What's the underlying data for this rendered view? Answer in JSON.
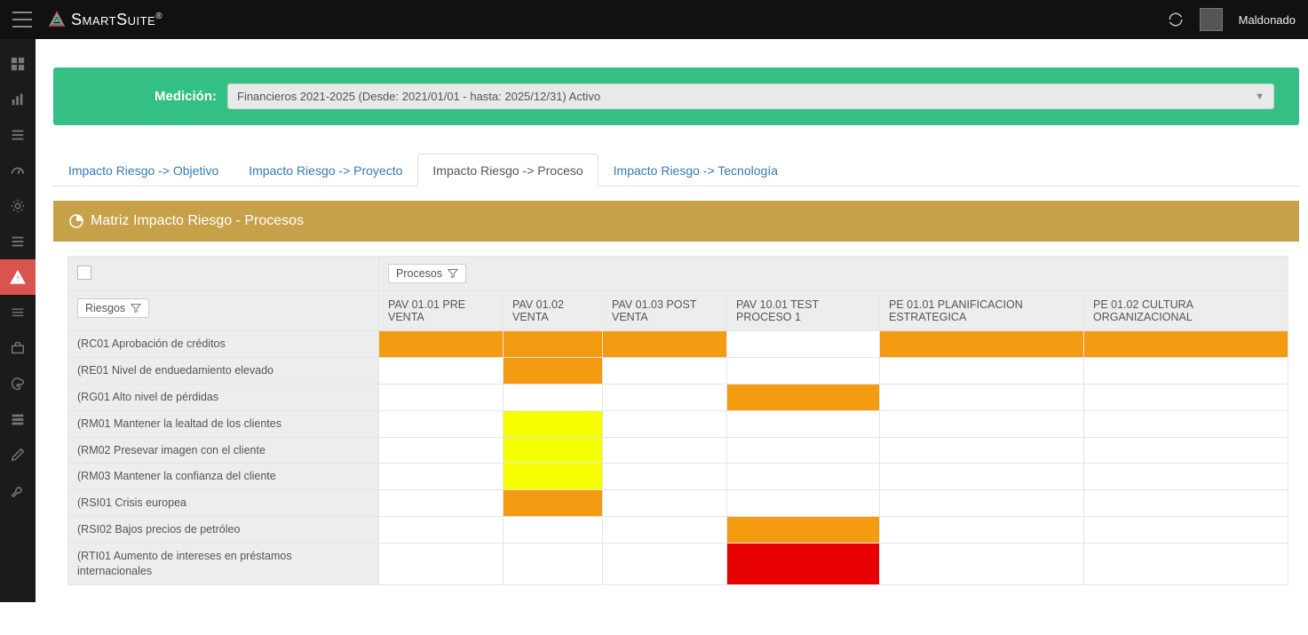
{
  "brand": "SmartSuite",
  "brand_mark": "®",
  "user": {
    "name": "Maldonado"
  },
  "siderail": [
    {
      "name": "dashboard-icon"
    },
    {
      "name": "bar-chart-icon"
    },
    {
      "name": "list-icon"
    },
    {
      "name": "gauge-icon"
    },
    {
      "name": "gear-icon"
    },
    {
      "name": "list2-icon"
    },
    {
      "name": "warning-icon",
      "active": true
    },
    {
      "name": "lines-icon"
    },
    {
      "name": "briefcase-icon"
    },
    {
      "name": "palette-icon"
    },
    {
      "name": "rows-icon"
    },
    {
      "name": "pencil-icon"
    },
    {
      "name": "wrench-icon"
    }
  ],
  "measurement": {
    "label": "Medición:",
    "value": "Financieros 2021-2025 (Desde: 2021/01/01 - hasta: 2025/12/31)  Activo"
  },
  "tabs": [
    {
      "label": "Impacto Riesgo -> Objetivo",
      "active": false
    },
    {
      "label": "Impacto Riesgo -> Proyecto",
      "active": false
    },
    {
      "label": "Impacto Riesgo -> Proceso",
      "active": true
    },
    {
      "label": "Impacto Riesgo -> Tecnología",
      "active": false
    }
  ],
  "panel_title": "Matriz Impacto Riesgo - Procesos",
  "filters": {
    "riesgos": "Riesgos",
    "procesos": "Procesos"
  },
  "columns": [
    "PAV 01.01 PRE VENTA",
    "PAV 01.02 VENTA",
    "PAV 01.03 POST VENTA",
    "PAV 10.01 TEST PROCESO 1",
    "PE 01.01 PLANIFICACION ESTRATEGICA",
    "PE 01.02 CULTURA ORGANIZACIONAL"
  ],
  "rows": [
    {
      "label": "(RC01 Aprobación de créditos",
      "tall": true,
      "cells": [
        "orange",
        "orange",
        "orange",
        "white",
        "orange",
        "orange"
      ]
    },
    {
      "label": "(RE01 Nivel de enduedamiento elevado",
      "cells": [
        "white",
        "orange",
        "white",
        "white",
        "white",
        "white"
      ]
    },
    {
      "label": "(RG01 Alto nivel de pérdidas",
      "cells": [
        "white",
        "white",
        "white",
        "orange",
        "white",
        "white"
      ]
    },
    {
      "label": "(RM01 Mantener la lealtad de los clientes",
      "cells": [
        "white",
        "yellow",
        "white",
        "white",
        "white",
        "white"
      ]
    },
    {
      "label": "(RM02 Presevar imagen con el cliente",
      "cells": [
        "white",
        "yellow",
        "white",
        "white",
        "white",
        "white"
      ]
    },
    {
      "label": "(RM03 Mantener la confianza del cliente",
      "cells": [
        "white",
        "yellow",
        "white",
        "white",
        "white",
        "white"
      ]
    },
    {
      "label": "(RSI01 Crisis europea",
      "cells": [
        "white",
        "orange",
        "white",
        "white",
        "white",
        "white"
      ]
    },
    {
      "label": "(RSI02 Bajos precios de petróleo",
      "cells": [
        "white",
        "white",
        "white",
        "orange",
        "white",
        "white"
      ]
    },
    {
      "label": "(RTI01 Aumento de intereses en préstamos internacionales",
      "tall": true,
      "cells": [
        "white",
        "white",
        "white",
        "red",
        "white",
        "white"
      ]
    }
  ],
  "colors": {
    "orange": "#f39c12",
    "yellow": "#f6ff00",
    "red": "#e60000"
  }
}
